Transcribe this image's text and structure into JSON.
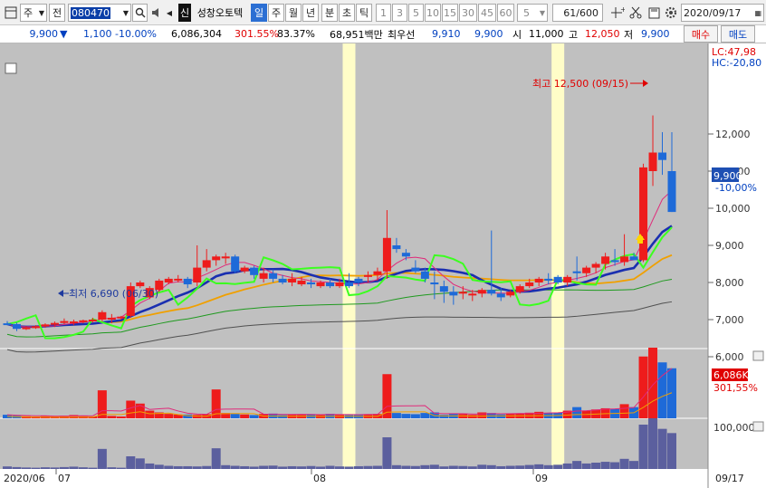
{
  "toolbar": {
    "market": "주",
    "market_type": "전",
    "code": "080470",
    "search_icon": "search",
    "speaker_icon": "speaker",
    "new_badge": "신",
    "stock_name": "성창오토텍",
    "periods": [
      "일",
      "주",
      "월",
      "년",
      "분",
      "초",
      "틱"
    ],
    "active_period": "일",
    "intervals": [
      "1",
      "3",
      "5",
      "10",
      "15",
      "30",
      "45",
      "60"
    ],
    "interval_value": "5",
    "bar_count": "61/600",
    "date": "2020/09/17",
    "icons": [
      "crosshair-icon",
      "scissors-icon",
      "save-icon",
      "gear-icon"
    ]
  },
  "quote": {
    "price": "9,900",
    "change_arrow": "▼",
    "change": "1,100",
    "change_pct": "-10.00%",
    "volume": "6,086,304",
    "volume_ratio": "301.55%",
    "turnover_ratio": "83.37%",
    "amount": "68,951백만",
    "bid_label": "최우선",
    "best_ask": "9,910",
    "best_bid": "9,900",
    "open_label": "시",
    "open": "11,000",
    "high_label": "고",
    "high": "12,050",
    "low_label": "저",
    "low": "9,900",
    "buy_label": "매수",
    "sell_label": "매도"
  },
  "panel": {
    "lc": "LC:47,98",
    "hc": "HC:-20,80",
    "price_ticks": [
      "12,000",
      "11,000",
      "10,000",
      "9,000",
      "8,000",
      "7,000",
      "6,000"
    ],
    "current_price": "9,900",
    "current_pct": "-10,00%",
    "high_note": "최고 12,500 (09/15)",
    "low_note": "최저 6,690 (06/30)",
    "vol_label": "6,086K",
    "vol_ratio": "301,55%",
    "vol2_tick": "100,000",
    "x_labels": [
      "2020/06",
      "07",
      "08",
      "09"
    ],
    "x_right": "09/17"
  },
  "chart_data": {
    "type": "candlestick",
    "title": "",
    "x_range": [
      "2020/06/29",
      "2020/09/17"
    ],
    "highlight_bars": [
      36,
      58
    ],
    "ohlc": [
      [
        6900,
        6960,
        6850,
        6880
      ],
      [
        6880,
        6920,
        6690,
        6750
      ],
      [
        6750,
        6820,
        6720,
        6790
      ],
      [
        6800,
        6850,
        6750,
        6820
      ],
      [
        6820,
        6900,
        6780,
        6870
      ],
      [
        6870,
        6950,
        6800,
        6910
      ],
      [
        6910,
        7030,
        6880,
        6960
      ],
      [
        6900,
        7000,
        6850,
        6950
      ],
      [
        6950,
        7000,
        6900,
        6980
      ],
      [
        6980,
        7050,
        6920,
        7000
      ],
      [
        7000,
        7250,
        6950,
        7200
      ],
      [
        7000,
        7150,
        6900,
        7050
      ],
      [
        7050,
        7100,
        7000,
        7080
      ],
      [
        7100,
        8000,
        7050,
        7900
      ],
      [
        7900,
        8050,
        7850,
        8000
      ],
      [
        7600,
        7900,
        7550,
        7850
      ],
      [
        7800,
        8100,
        7750,
        8050
      ],
      [
        8000,
        8150,
        7950,
        8100
      ],
      [
        8100,
        8200,
        8000,
        8100
      ],
      [
        8100,
        8150,
        7850,
        7950
      ],
      [
        8000,
        9000,
        7900,
        8400
      ],
      [
        8400,
        8900,
        8300,
        8600
      ],
      [
        8600,
        8750,
        8450,
        8700
      ],
      [
        8650,
        8800,
        8500,
        8700
      ],
      [
        8700,
        8750,
        8250,
        8300
      ],
      [
        8300,
        8450,
        8250,
        8400
      ],
      [
        8400,
        8450,
        8100,
        8200
      ],
      [
        8100,
        8400,
        8000,
        8250
      ],
      [
        8250,
        8350,
        8000,
        8100
      ],
      [
        8100,
        8200,
        7950,
        8000
      ],
      [
        8000,
        8250,
        7900,
        8100
      ],
      [
        7950,
        8150,
        7900,
        8050
      ],
      [
        8000,
        8100,
        7850,
        7950
      ],
      [
        7900,
        8050,
        7850,
        8000
      ],
      [
        8000,
        8100,
        7850,
        7900
      ],
      [
        7900,
        8100,
        7850,
        8000
      ],
      [
        8000,
        8250,
        7850,
        7900
      ],
      [
        8100,
        8150,
        7900,
        8000
      ],
      [
        8150,
        8300,
        8000,
        8200
      ],
      [
        8200,
        8400,
        8050,
        8300
      ],
      [
        8300,
        9950,
        8100,
        9200
      ],
      [
        9000,
        9200,
        8800,
        8900
      ],
      [
        8800,
        8900,
        8600,
        8700
      ],
      [
        8400,
        8600,
        8250,
        8300
      ],
      [
        8300,
        8400,
        8000,
        8100
      ],
      [
        8000,
        8300,
        7550,
        7950
      ],
      [
        7900,
        8050,
        7450,
        7750
      ],
      [
        7750,
        7900,
        7400,
        7650
      ],
      [
        7700,
        7900,
        7550,
        7750
      ],
      [
        7650,
        7800,
        7500,
        7700
      ],
      [
        7700,
        7850,
        7600,
        7800
      ],
      [
        7800,
        9400,
        7650,
        7700
      ],
      [
        7700,
        7850,
        7500,
        7600
      ],
      [
        7650,
        7800,
        7600,
        7750
      ],
      [
        7750,
        7950,
        7700,
        7900
      ],
      [
        7900,
        8100,
        7850,
        8000
      ],
      [
        8000,
        8150,
        7900,
        8100
      ],
      [
        8100,
        8250,
        7950,
        8050
      ],
      [
        8150,
        8200,
        7950,
        8000
      ],
      [
        8000,
        8200,
        7900,
        8150
      ],
      [
        8300,
        8700,
        8050,
        8250
      ],
      [
        8250,
        8450,
        8150,
        8400
      ],
      [
        8400,
        8550,
        8250,
        8500
      ],
      [
        8500,
        8800,
        8350,
        8700
      ],
      [
        8600,
        8900,
        8450,
        8550
      ],
      [
        8550,
        9300,
        8450,
        8700
      ],
      [
        8700,
        8800,
        8600,
        8600
      ],
      [
        8600,
        11200,
        8550,
        11100
      ],
      [
        11000,
        12500,
        10600,
        11500
      ],
      [
        11500,
        12050,
        10900,
        11300
      ],
      [
        11000,
        12050,
        9900,
        9900
      ]
    ],
    "volume": [
      120,
      90,
      70,
      60,
      80,
      70,
      90,
      110,
      80,
      60,
      950,
      80,
      60,
      600,
      500,
      260,
      200,
      150,
      130,
      130,
      120,
      140,
      980,
      180,
      150,
      130,
      110,
      150,
      160,
      110,
      130,
      120,
      140,
      110,
      150,
      120,
      110,
      130,
      140,
      150,
      1500,
      180,
      150,
      140,
      180,
      200,
      120,
      150,
      140,
      120,
      200,
      180,
      130,
      150,
      160,
      190,
      220,
      180,
      200,
      260,
      380,
      260,
      300,
      340,
      320,
      480,
      380,
      2100,
      2400,
      1900,
      1700
    ]
  }
}
